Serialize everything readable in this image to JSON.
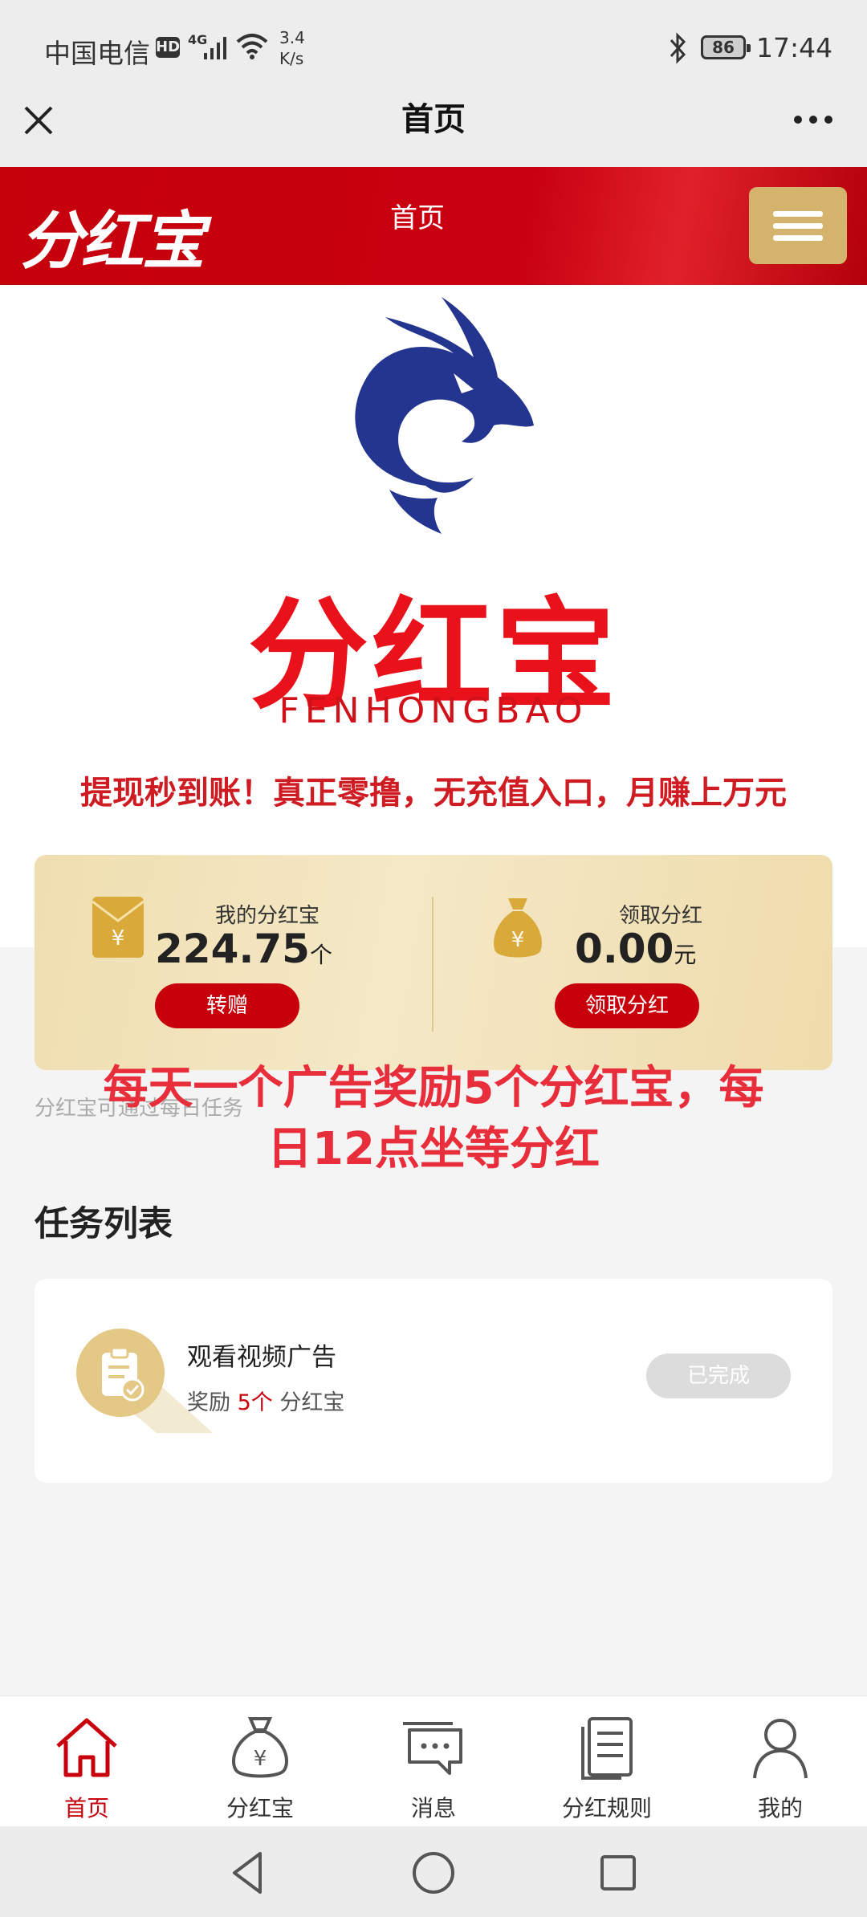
{
  "status_bar": {
    "carrier": "中国电信",
    "hd_badge": "HD",
    "network": "4G",
    "speed": "3.4 K/s",
    "battery": "86",
    "time": "17:44"
  },
  "title_bar": {
    "title": "首页",
    "close_icon": "close-icon",
    "more_icon": "more-icon"
  },
  "site_header": {
    "logo": "分红宝",
    "nav_title": "首页",
    "menu_icon": "hamburger-icon"
  },
  "banner": {
    "brand_cn": "分红宝",
    "brand_en": "FENHONGBAO",
    "slogan": "提现秒到账！真正零撸，无充值入口，月赚上万元"
  },
  "dividend_card": {
    "left": {
      "label": "我的分红宝",
      "value": "224.75",
      "unit": "个",
      "button": "转赠"
    },
    "right": {
      "label": "领取分红",
      "value": "0.00",
      "unit": "元",
      "button": "领取分红"
    }
  },
  "overlay_caption": {
    "line1": "每天一个广告奖励5个分红宝，每",
    "line2": "日12点坐等分红"
  },
  "hint": "分红宝可通过每日任务",
  "task_section": {
    "title": "任务列表",
    "tasks": [
      {
        "title": "观看视频广告",
        "reward_prefix": "奖励",
        "reward_amount": "5个",
        "reward_suffix": "分红宝",
        "status": "已完成"
      }
    ]
  },
  "tabbar": {
    "items": [
      {
        "label": "首页",
        "icon": "home-icon",
        "active": true
      },
      {
        "label": "分红宝",
        "icon": "money-bag-icon",
        "active": false
      },
      {
        "label": "消息",
        "icon": "message-icon",
        "active": false
      },
      {
        "label": "分红规则",
        "icon": "document-icon",
        "active": false
      },
      {
        "label": "我的",
        "icon": "user-icon",
        "active": false
      }
    ]
  },
  "colors": {
    "brand_red": "#c7000b",
    "gold": "#d4b46c",
    "overlay_red": "#e82e3a"
  }
}
